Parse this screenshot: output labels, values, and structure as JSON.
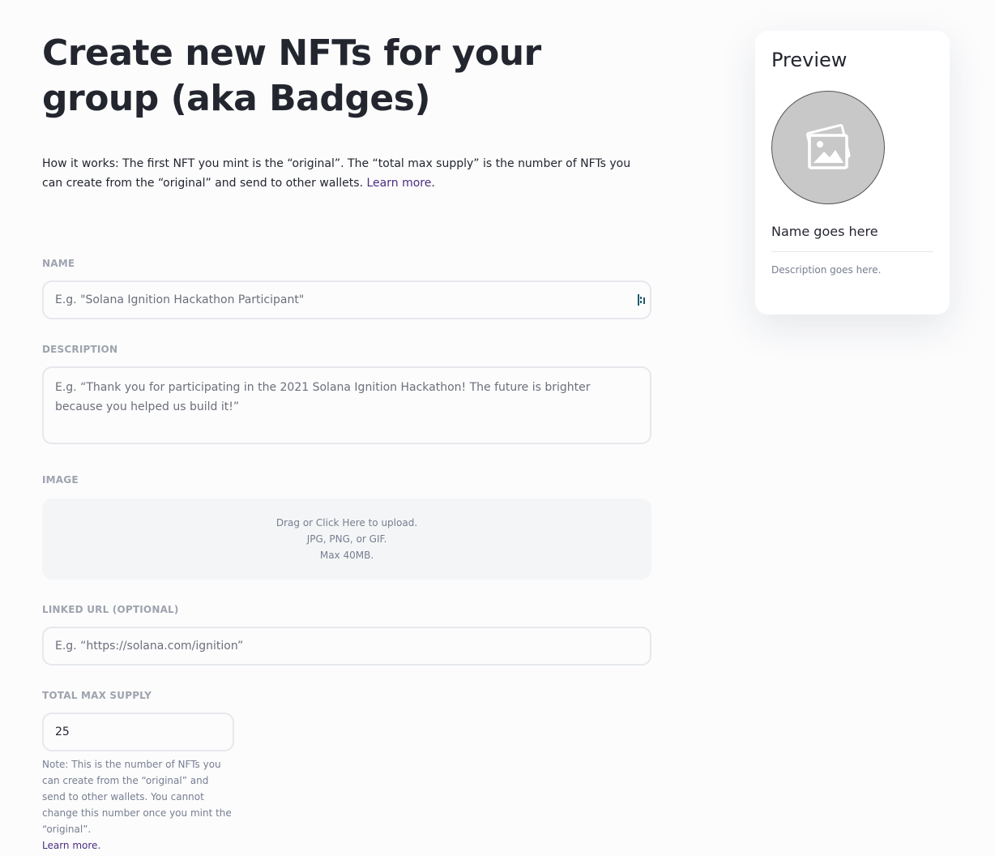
{
  "header": {
    "title": "Create new NFTs for your group (aka Badges)"
  },
  "intro": {
    "text": "How it works: The first NFT you mint is the “original”. The “total max supply” is the number of NFTs you can create from the “original” and send to other wallets. ",
    "link": "Learn more",
    "suffix": "."
  },
  "form": {
    "name": {
      "label": "NAME",
      "placeholder": "E.g. \"Solana Ignition Hackathon Participant\""
    },
    "description": {
      "label": "DESCRIPTION",
      "placeholder": "E.g. “Thank you for participating in the 2021 Solana Ignition Hackathon! The future is brighter because you helped us build it!”"
    },
    "image": {
      "label": "IMAGE",
      "line1": "Drag or Click Here to upload.",
      "line2": "JPG, PNG, or GIF.",
      "line3": "Max 40MB."
    },
    "linked_url": {
      "label": "LINKED URL (OPTIONAL)",
      "placeholder": "E.g. “https://solana.com/ignition”"
    },
    "max_supply": {
      "label": "TOTAL MAX SUPPLY",
      "value": "25",
      "note": "Note: This is the number of NFTs you can create from the “original” and send to other wallets. You cannot change this number once you mint the “original”.",
      "note_link": "Learn more."
    }
  },
  "preview": {
    "title": "Preview",
    "image_icon": "image-placeholder-icon",
    "name": "Name goes here",
    "description": "Description goes here."
  },
  "colors": {
    "link": "#4b2d7f",
    "label": "#9ea3ae",
    "border": "#e6e8ec",
    "upload_bg": "#f4f5f6",
    "preview_circle": "#c8c8c8",
    "password_icon": "#1f5a6b"
  }
}
